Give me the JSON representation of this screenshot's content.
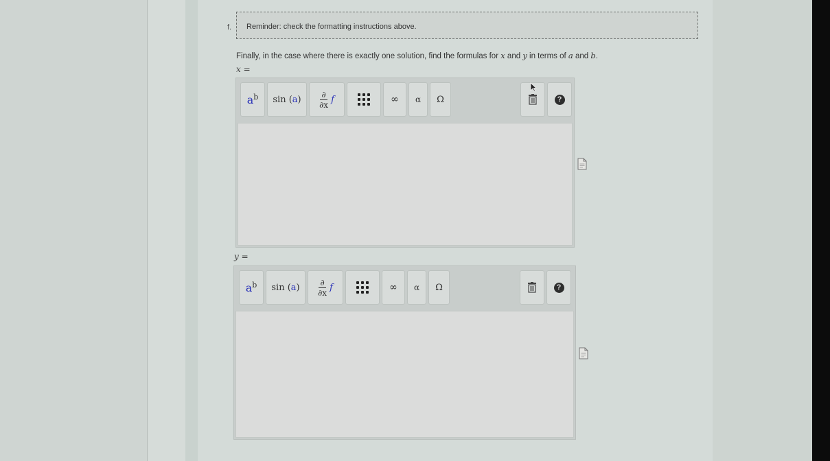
{
  "question": {
    "number": "f.",
    "reminder": "Reminder: check the formatting instructions above.",
    "prompt_parts": {
      "before_x": "Finally, in the case where there is exactly one solution, find the formulas for ",
      "x_var": "x",
      "between": " and ",
      "y_var": "y",
      "before_a": " in terms of ",
      "a_var": "a",
      "and": " and ",
      "b_var": "b",
      "end": "."
    }
  },
  "editors": [
    {
      "label": "x =",
      "toolbar": {
        "power": {
          "base": "a",
          "exp": "b"
        },
        "sin": {
          "fn": "sin",
          "arg": "a"
        },
        "derivative": {
          "num": "∂",
          "den": "∂x",
          "fn": "f"
        },
        "matrix_icon": "matrix-icon",
        "infinity": "∞",
        "alpha": "α",
        "omega": "Ω",
        "trash_icon": "trash-icon",
        "help": "?"
      },
      "value": ""
    },
    {
      "label": "y =",
      "toolbar": {
        "power": {
          "base": "a",
          "exp": "b"
        },
        "sin": {
          "fn": "sin",
          "arg": "a"
        },
        "derivative": {
          "num": "∂",
          "den": "∂x",
          "fn": "f"
        },
        "matrix_icon": "matrix-icon",
        "infinity": "∞",
        "alpha": "α",
        "omega": "Ω",
        "trash_icon": "trash-icon",
        "help": "?"
      },
      "value": ""
    }
  ],
  "colors": {
    "page_bg": "#d4dbd8",
    "accent_blue": "#2a32b8",
    "toolbar_bg": "#c8cdcb",
    "input_bg": "#dbdcdb"
  }
}
